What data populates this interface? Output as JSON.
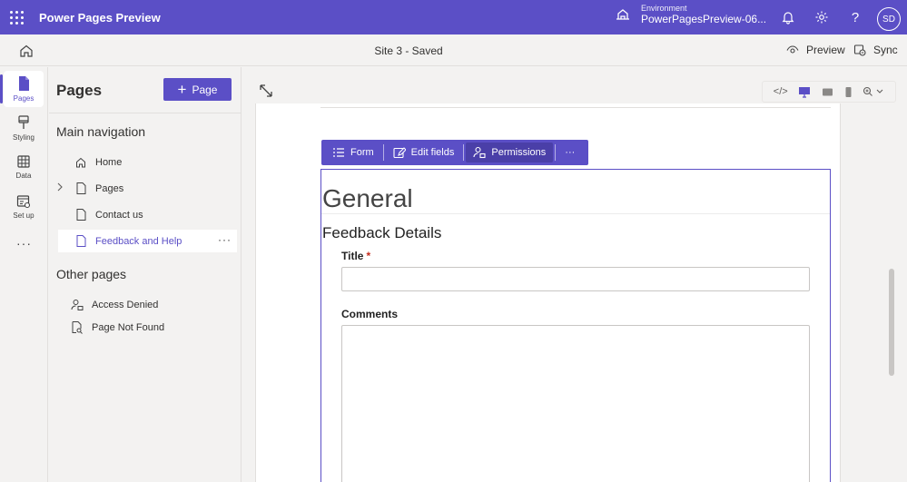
{
  "header": {
    "app_title": "Power Pages Preview",
    "environment_label": "Environment",
    "environment_name": "PowerPagesPreview-06...",
    "avatar_initials": "SD"
  },
  "command_bar": {
    "site_status": "Site 3 - Saved",
    "preview_label": "Preview",
    "sync_label": "Sync"
  },
  "rail": {
    "items": [
      {
        "label": "Pages",
        "icon": "page-icon",
        "active": true
      },
      {
        "label": "Styling",
        "icon": "paintbrush-icon",
        "active": false
      },
      {
        "label": "Data",
        "icon": "table-icon",
        "active": false
      },
      {
        "label": "Set up",
        "icon": "settings-window-icon",
        "active": false
      }
    ],
    "more": "···"
  },
  "pages_panel": {
    "title": "Pages",
    "add_button": "Page",
    "main_nav_heading": "Main navigation",
    "main_nav": [
      {
        "label": "Home",
        "icon": "home-icon"
      },
      {
        "label": "Pages",
        "icon": "page-icon",
        "expandable": true
      },
      {
        "label": "Contact us",
        "icon": "page-icon"
      },
      {
        "label": "Feedback and Help",
        "icon": "page-icon",
        "selected": true
      }
    ],
    "other_heading": "Other pages",
    "other_pages": [
      {
        "label": "Access Denied",
        "icon": "person-lock-icon"
      },
      {
        "label": "Page Not Found",
        "icon": "page-search-icon"
      }
    ],
    "more_dots": "···"
  },
  "form_toolbar": {
    "form_label": "Form",
    "edit_fields_label": "Edit fields",
    "permissions_label": "Permissions",
    "more_label": "···"
  },
  "form": {
    "heading": "General",
    "section": "Feedback Details",
    "fields": [
      {
        "label": "Title",
        "required": true,
        "value": ""
      },
      {
        "label": "Comments",
        "required": false,
        "value": ""
      }
    ],
    "required_marker": "*"
  },
  "colors": {
    "brand": "#5b4fc6",
    "required": "#c42b1c"
  }
}
